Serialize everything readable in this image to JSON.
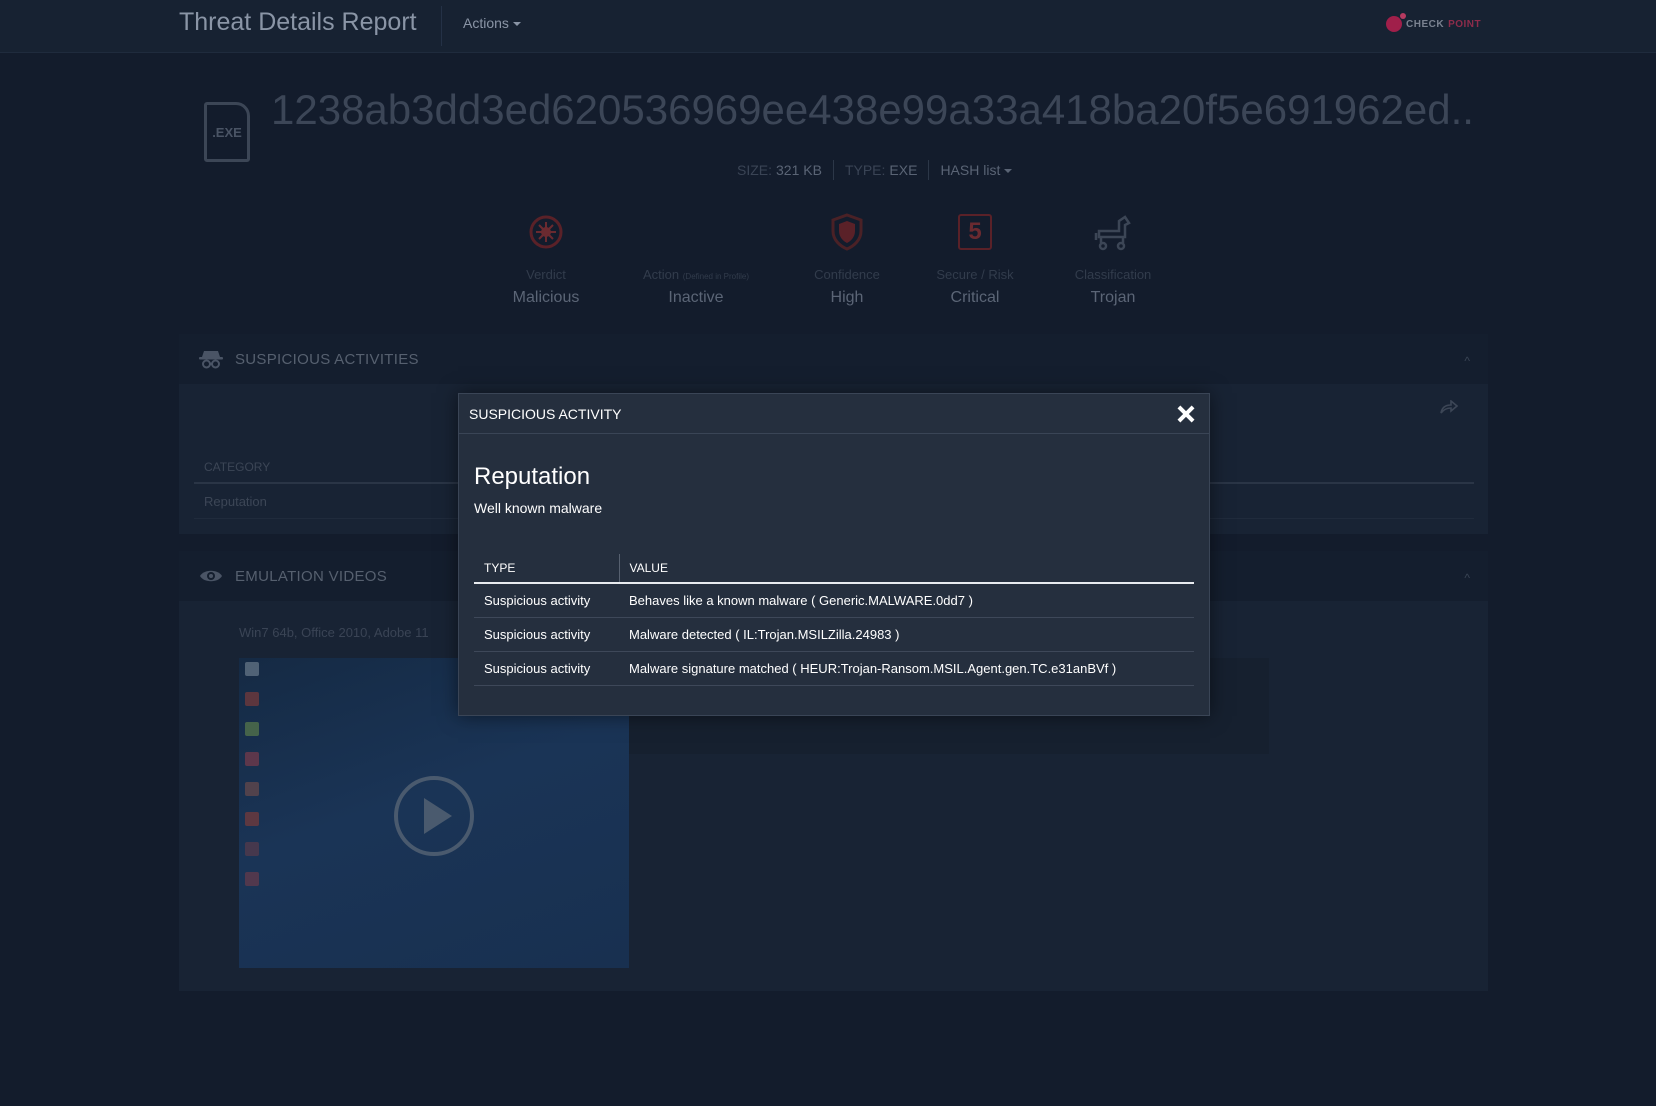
{
  "header": {
    "title": "Threat Details Report",
    "actions_label": "Actions",
    "brand_part1": "CHECK",
    "brand_part2": "POINT"
  },
  "file": {
    "icon_label": ".EXE",
    "hash": "1238ab3dd3ed620536969ee438e99a33a418ba20f5e691962ed...",
    "size_label": "SIZE:",
    "size_value": "321 KB",
    "type_label": "TYPE:",
    "type_value": "EXE",
    "hash_list_label": "HASH list"
  },
  "verdicts": [
    {
      "label": "Verdict",
      "value": "Malicious",
      "icon": "malicious-icon"
    },
    {
      "label": "Action",
      "label_note": "(Defined in Profile)",
      "value": "Inactive",
      "icon": ""
    },
    {
      "label": "Confidence",
      "value": "High",
      "icon": "shield-icon"
    },
    {
      "label": "Secure / Risk",
      "value": "Critical",
      "risk_score": "5",
      "icon": "risk-score-icon"
    },
    {
      "label": "Classification",
      "value": "Trojan",
      "icon": "trojan-horse-icon"
    }
  ],
  "sections": {
    "suspicious": {
      "title": "SUSPICIOUS ACTIVITIES",
      "category_header": "CATEGORY",
      "category_row": "Reputation"
    },
    "emulation": {
      "title": "EMULATION VIDEOS",
      "env_label": "Win7 64b, Office 2010, Adobe 11"
    }
  },
  "modal": {
    "title": "SUSPICIOUS ACTIVITY",
    "reputation_title": "Reputation",
    "reputation_sub": "Well known malware",
    "columns": [
      "TYPE",
      "VALUE"
    ],
    "rows": [
      {
        "type": "Suspicious activity",
        "value": "Behaves like a known malware ( Generic.MALWARE.0dd7 )"
      },
      {
        "type": "Suspicious activity",
        "value": "Malware detected ( IL:Trojan.MSILZilla.24983 )"
      },
      {
        "type": "Suspicious activity",
        "value": "Malware signature matched ( HEUR:Trojan-Ransom.MSIL.Agent.gen.TC.e31anBVf )"
      }
    ]
  },
  "colors": {
    "background": "#131c2c",
    "modal_bg": "#252f3e",
    "risk_red": "#6a2a30",
    "brand_red": "#a01f4a"
  }
}
